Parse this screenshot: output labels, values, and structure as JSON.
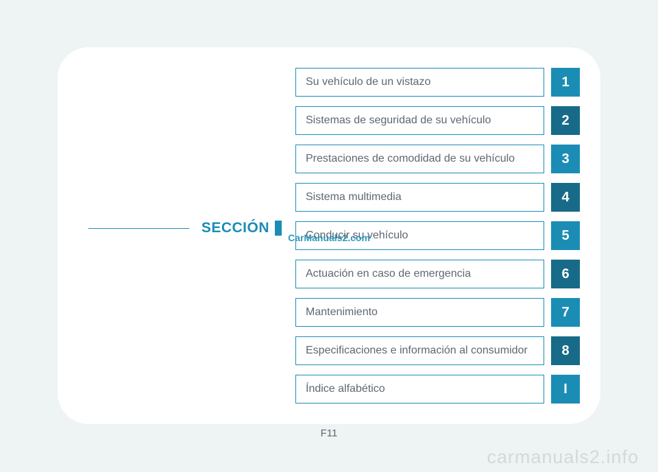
{
  "section_label": "SECCIÓN",
  "toc": {
    "items": [
      {
        "label": "Su vehículo de un vistazo",
        "num": "1",
        "shade": "light"
      },
      {
        "label": "Sistemas de seguridad de su vehículo",
        "num": "2",
        "shade": "dark"
      },
      {
        "label": "Prestaciones de comodidad de su vehículo",
        "num": "3",
        "shade": "light"
      },
      {
        "label": "Sistema multimedia",
        "num": "4",
        "shade": "dark"
      },
      {
        "label": "Conducir su vehículo",
        "num": "5",
        "shade": "light"
      },
      {
        "label": "Actuación en caso de emergencia",
        "num": "6",
        "shade": "dark"
      },
      {
        "label": "Mantenimiento",
        "num": "7",
        "shade": "light"
      },
      {
        "label": "Especificaciones e información al consumidor",
        "num": "8",
        "shade": "dark"
      },
      {
        "label": "Índice alfabético",
        "num": "I",
        "shade": "light"
      }
    ]
  },
  "page_number": "F11",
  "watermark_center": "CarManuals2.com",
  "watermark_bottom": "carmanuals2.info"
}
